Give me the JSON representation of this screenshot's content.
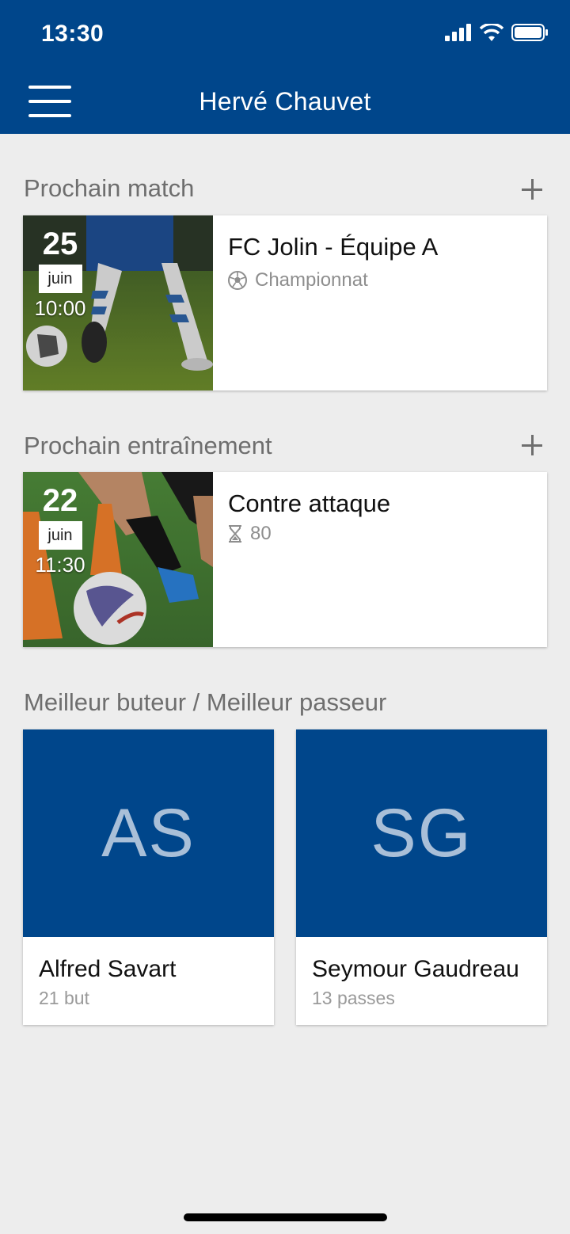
{
  "status": {
    "time": "13:30"
  },
  "appbar": {
    "title": "Hervé Chauvet"
  },
  "next_match": {
    "section_title": "Prochain match",
    "day": "25",
    "month": "juin",
    "time": "10:00",
    "title": "FC Jolin - Équipe A",
    "subtitle": "Championnat"
  },
  "next_training": {
    "section_title": "Prochain entraînement",
    "day": "22",
    "month": "juin",
    "time": "11:30",
    "title": "Contre attaque",
    "subtitle": "80"
  },
  "top_players": {
    "section_title": "Meilleur buteur / Meilleur passeur",
    "players": [
      {
        "initials": "AS",
        "name": "Alfred Savart",
        "stat": "21 but"
      },
      {
        "initials": "SG",
        "name": "Seymour Gaudreau",
        "stat": "13 passes"
      }
    ]
  },
  "colors": {
    "primary": "#00468b",
    "background": "#ededed",
    "avatar_text": "#a9bfd8"
  }
}
